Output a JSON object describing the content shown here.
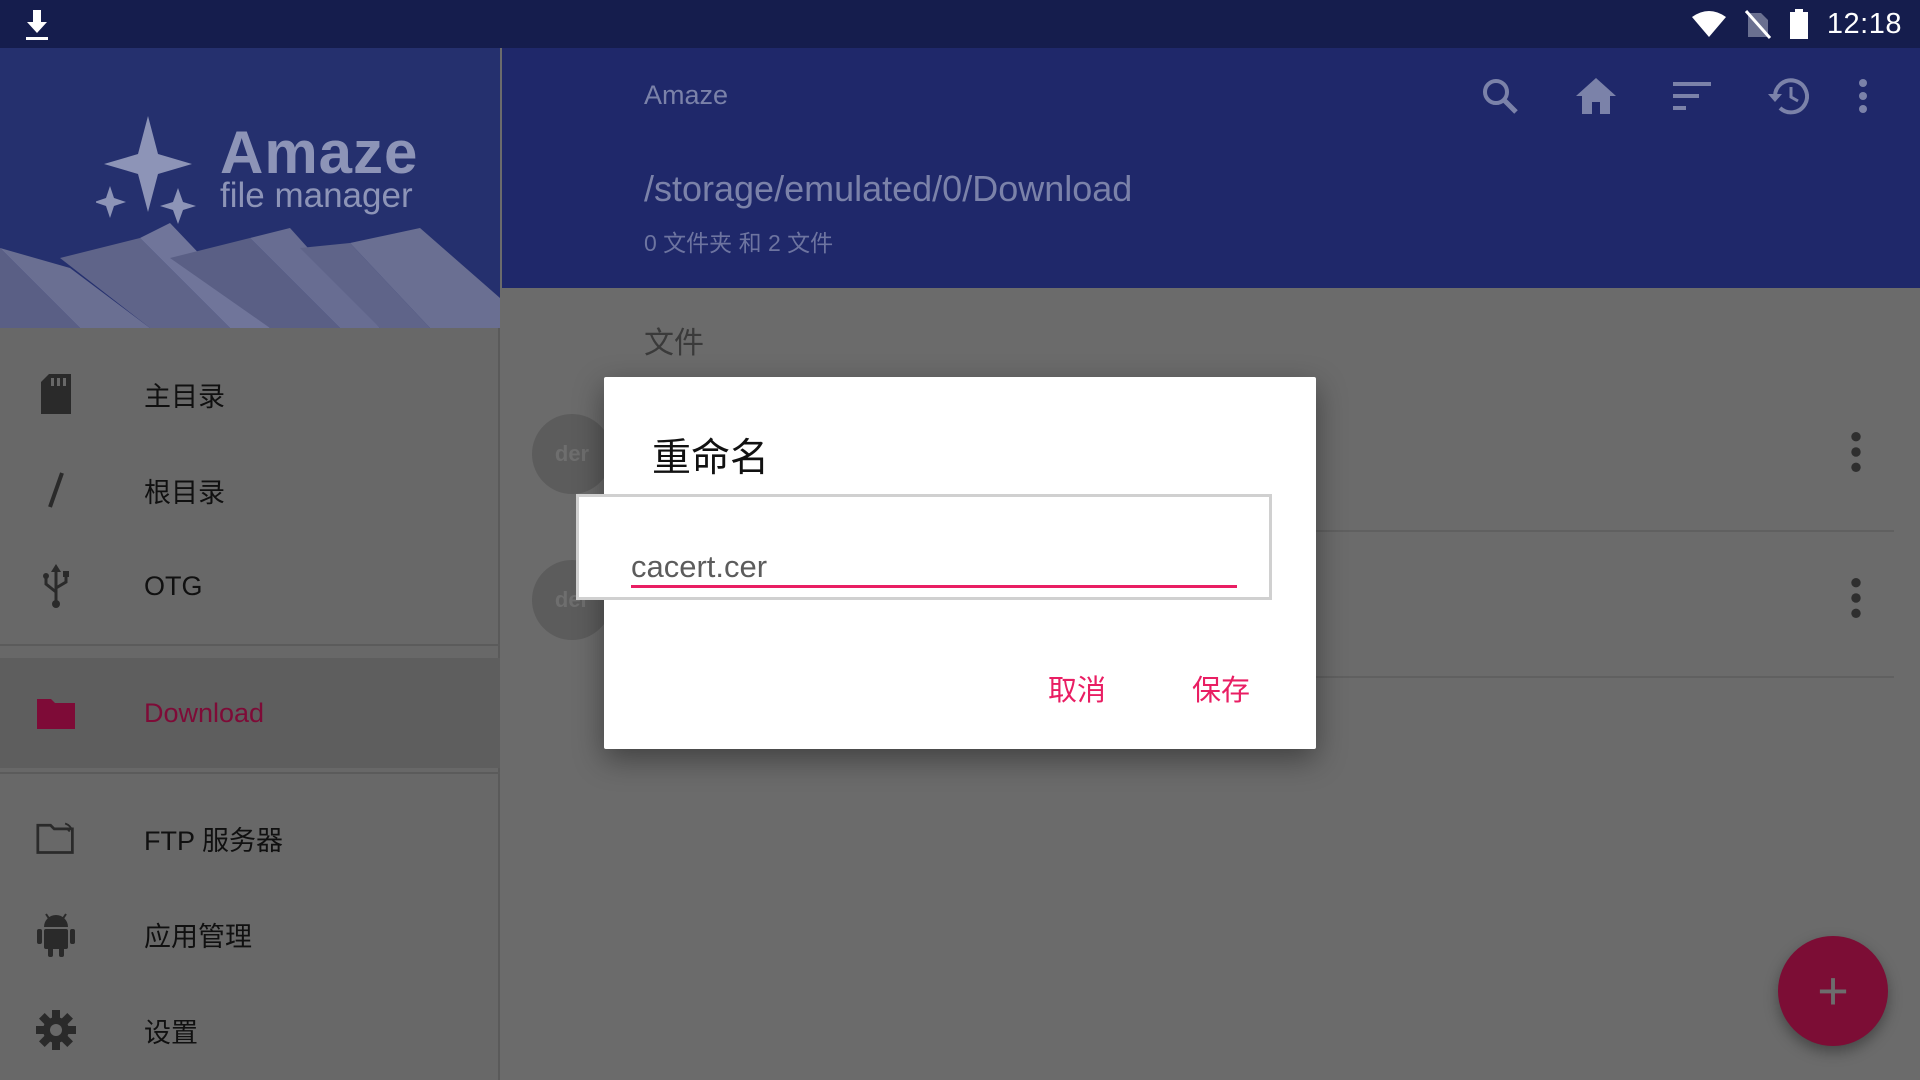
{
  "status_bar": {
    "time": "12:18",
    "icons": [
      "download-icon",
      "wifi-icon",
      "no-sim-icon",
      "battery-icon"
    ]
  },
  "drawer": {
    "logo_title": "Amaze",
    "logo_subtitle": "file manager",
    "items": [
      {
        "label": "主目录",
        "icon": "sd-card-icon"
      },
      {
        "label": "根目录",
        "icon": "slash-icon"
      },
      {
        "label": "OTG",
        "icon": "usb-icon"
      },
      {
        "label": "Download",
        "icon": "folder-icon",
        "active": true
      },
      {
        "label": "FTP 服务器",
        "icon": "ftp-folder-icon"
      },
      {
        "label": "应用管理",
        "icon": "android-icon"
      },
      {
        "label": "设置",
        "icon": "gear-icon"
      }
    ]
  },
  "toolbar": {
    "title": "Amaze",
    "path": "/storage/emulated/0/Download",
    "summary": "0 文件夹 和 2 文件",
    "actions": [
      "search-icon",
      "home-icon",
      "sort-icon",
      "history-icon",
      "more-vert-icon"
    ]
  },
  "content": {
    "section_header": "文件",
    "files": [
      {
        "avatar": "der"
      },
      {
        "avatar": "der"
      }
    ]
  },
  "dialog": {
    "title": "重命名",
    "input_value": "cacert.cer",
    "cancel_label": "取消",
    "save_label": "保存"
  },
  "fab": {
    "label": "+"
  },
  "colors": {
    "accent": "#e91e63",
    "primary": "#283593",
    "scrim_primary": "#1f286a"
  }
}
